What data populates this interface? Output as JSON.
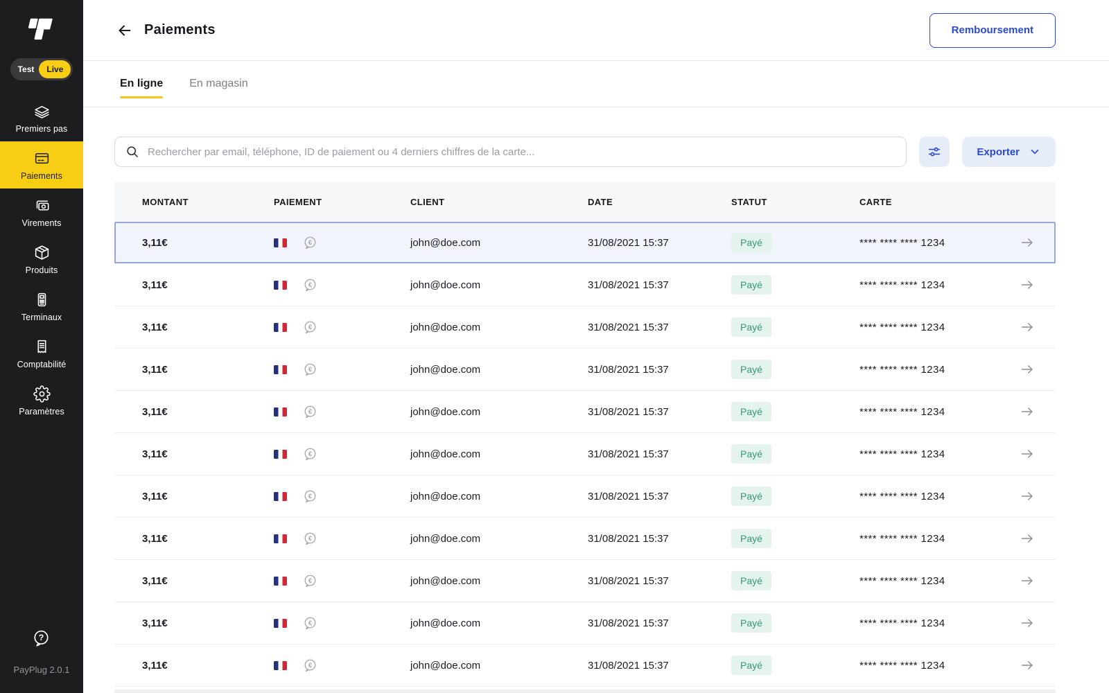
{
  "colors": {
    "brand_yellow": "#F7CE14",
    "accent_blue": "#2B4ACB",
    "accent_blue_bg": "#E7ECF9",
    "sidebar_bg": "#1D1D1F",
    "status_paid_text": "#2F9B70",
    "status_paid_bg": "#E4F3EC",
    "selected_row_bg": "#F1F4FB",
    "selected_row_border": "#99A5D9",
    "flag_blue": "#26317D",
    "flag_red": "#CE2939"
  },
  "sidebar": {
    "toggle": {
      "test": "Test",
      "live": "Live",
      "selected": "Live"
    },
    "items": [
      {
        "id": "premiers-pas",
        "label": "Premiers pas",
        "icon": "layers",
        "active": false
      },
      {
        "id": "paiements",
        "label": "Paiements",
        "icon": "card",
        "active": true
      },
      {
        "id": "virements",
        "label": "Virements",
        "icon": "banknote",
        "active": false
      },
      {
        "id": "produits",
        "label": "Produits",
        "icon": "box",
        "active": false
      },
      {
        "id": "terminaux",
        "label": "Terminaux",
        "icon": "terminal",
        "active": false
      },
      {
        "id": "comptabilite",
        "label": "Comptabilité",
        "icon": "receipt",
        "active": false
      },
      {
        "id": "parametres",
        "label": "Paramètres",
        "icon": "gear",
        "active": false
      }
    ],
    "help_icon": "help-bubble",
    "version": "PayPlug 2.0.1"
  },
  "header": {
    "back_icon": "arrow-left",
    "title": "Paiements",
    "refund_button": "Remboursement"
  },
  "tabs": [
    {
      "id": "en-ligne",
      "label": "En ligne",
      "active": true
    },
    {
      "id": "en-magasin",
      "label": "En magasin",
      "active": false
    }
  ],
  "toolbar": {
    "search_icon": "magnifier",
    "search_placeholder": "Rechercher par email, téléphone, ID de paiement ou 4 derniers chiffres de la carte...",
    "filter_icon": "sliders",
    "export_label": "Exporter",
    "export_chevron_icon": "chevron-down"
  },
  "table": {
    "columns": [
      "MONTANT",
      "PAIEMENT",
      "CLIENT",
      "DATE",
      "STATUT",
      "CARTE"
    ],
    "payment_icons": [
      "france-flag",
      "euro-currency"
    ],
    "rows": [
      {
        "montant": "3,11€",
        "client": "john@doe.com",
        "date": "31/08/2021 15:37",
        "statut": "Payé",
        "carte": "**** **** **** 1234",
        "selected": true
      },
      {
        "montant": "3,11€",
        "client": "john@doe.com",
        "date": "31/08/2021 15:37",
        "statut": "Payé",
        "carte": "**** **** **** 1234",
        "selected": false
      },
      {
        "montant": "3,11€",
        "client": "john@doe.com",
        "date": "31/08/2021 15:37",
        "statut": "Payé",
        "carte": "**** **** **** 1234",
        "selected": false
      },
      {
        "montant": "3,11€",
        "client": "john@doe.com",
        "date": "31/08/2021 15:37",
        "statut": "Payé",
        "carte": "**** **** **** 1234",
        "selected": false
      },
      {
        "montant": "3,11€",
        "client": "john@doe.com",
        "date": "31/08/2021 15:37",
        "statut": "Payé",
        "carte": "**** **** **** 1234",
        "selected": false
      },
      {
        "montant": "3,11€",
        "client": "john@doe.com",
        "date": "31/08/2021 15:37",
        "statut": "Payé",
        "carte": "**** **** **** 1234",
        "selected": false
      },
      {
        "montant": "3,11€",
        "client": "john@doe.com",
        "date": "31/08/2021 15:37",
        "statut": "Payé",
        "carte": "**** **** **** 1234",
        "selected": false
      },
      {
        "montant": "3,11€",
        "client": "john@doe.com",
        "date": "31/08/2021 15:37",
        "statut": "Payé",
        "carte": "**** **** **** 1234",
        "selected": false
      },
      {
        "montant": "3,11€",
        "client": "john@doe.com",
        "date": "31/08/2021 15:37",
        "statut": "Payé",
        "carte": "**** **** **** 1234",
        "selected": false
      },
      {
        "montant": "3,11€",
        "client": "john@doe.com",
        "date": "31/08/2021 15:37",
        "statut": "Payé",
        "carte": "**** **** **** 1234",
        "selected": false
      },
      {
        "montant": "3,11€",
        "client": "john@doe.com",
        "date": "31/08/2021 15:37",
        "statut": "Payé",
        "carte": "**** **** **** 1234",
        "selected": false
      }
    ]
  }
}
